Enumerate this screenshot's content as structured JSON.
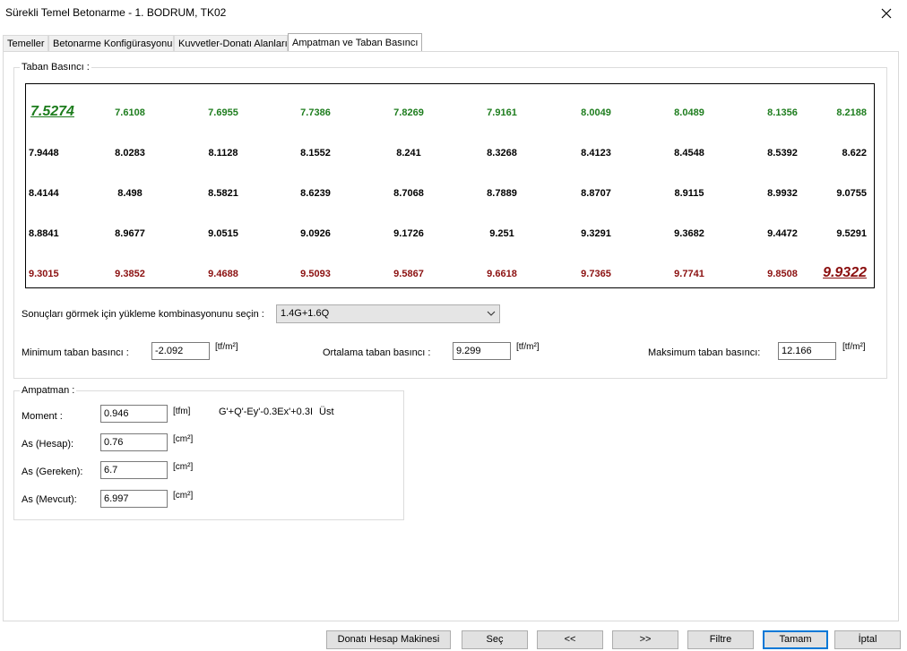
{
  "window": {
    "title": "Sürekli Temel Betonarme - 1. BODRUM, TK02"
  },
  "tabs": [
    {
      "label": "Temeller"
    },
    {
      "label": "Betonarme Konfigürasyonu"
    },
    {
      "label": "Kuvvetler-Donatı Alanları"
    },
    {
      "label": "Ampatman ve Taban Basıncı",
      "active": true
    }
  ],
  "taban_basinci": {
    "group_label": "Taban Basıncı :",
    "grid": [
      [
        "7.5274",
        "7.6108",
        "7.6955",
        "7.7386",
        "7.8269",
        "7.9161",
        "8.0049",
        "8.0489",
        "8.1356",
        "8.2188"
      ],
      [
        "7.9448",
        "8.0283",
        "8.1128",
        "8.1552",
        "8.241",
        "8.3268",
        "8.4123",
        "8.4548",
        "8.5392",
        "8.622"
      ],
      [
        "8.4144",
        "8.498",
        "8.5821",
        "8.6239",
        "8.7068",
        "8.7889",
        "8.8707",
        "8.9115",
        "8.9932",
        "9.0755"
      ],
      [
        "8.8841",
        "8.9677",
        "9.0515",
        "9.0926",
        "9.1726",
        "9.251",
        "9.3291",
        "9.3682",
        "9.4472",
        "9.5291"
      ],
      [
        "9.3015",
        "9.3852",
        "9.4688",
        "9.5093",
        "9.5867",
        "9.6618",
        "9.7365",
        "9.7741",
        "9.8508",
        "9.9322"
      ]
    ],
    "row_colors": [
      "#1e7d1e",
      "#000000",
      "#000000",
      "#000000",
      "#8b1010"
    ],
    "combo_label": "Sonuçları görmek için yükleme kombinasyonunu seçin :",
    "combo_value": "1.4G+1.6Q",
    "min_label": "Minimum taban basıncı :",
    "min_value": "-2.092",
    "avg_label": "Ortalama taban basıncı :",
    "avg_value": "9.299",
    "max_label": "Maksimum taban basıncı:",
    "max_value": "12.166",
    "unit": "[tf/m²]"
  },
  "ampatman": {
    "group_label": "Ampatman :",
    "moment_label": "Moment :",
    "moment_value": "0.946",
    "moment_unit": "[tfm]",
    "combo_text": "G'+Q'-Ey'-0.3Ex'+0.3I",
    "side_text": "Üst",
    "as_hesap_label": "As (Hesap):",
    "as_hesap_value": "0.76",
    "as_gereken_label": "As (Gereken):",
    "as_gereken_value": "6.7",
    "as_mevcut_label": "As (Mevcut):",
    "as_mevcut_value": "6.997",
    "area_unit": "[cm²]"
  },
  "buttons": {
    "donati": "Donatı Hesap Makinesi",
    "sec": "Seç",
    "prev": "<<",
    "next": ">>",
    "filtre": "Filtre",
    "tamam": "Tamam",
    "iptal": "İptal"
  },
  "icons": {
    "close": "close-icon",
    "dropdown": "chevron-down-icon"
  }
}
